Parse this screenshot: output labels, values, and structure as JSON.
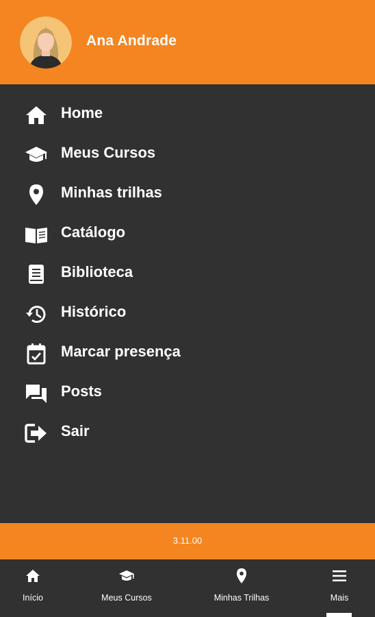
{
  "user": {
    "name": "Ana Andrade"
  },
  "menu": {
    "items": [
      {
        "label": "Home",
        "icon": "home-icon"
      },
      {
        "label": "Meus Cursos",
        "icon": "graduation-cap-icon"
      },
      {
        "label": "Minhas trilhas",
        "icon": "map-pin-icon"
      },
      {
        "label": "Catálogo",
        "icon": "open-book-icon"
      },
      {
        "label": "Biblioteca",
        "icon": "book-icon"
      },
      {
        "label": "Histórico",
        "icon": "history-icon"
      },
      {
        "label": "Marcar presença",
        "icon": "calendar-check-icon"
      },
      {
        "label": "Posts",
        "icon": "chat-bubbles-icon"
      },
      {
        "label": "Sair",
        "icon": "logout-icon"
      }
    ]
  },
  "version": "3.11.00",
  "bottom_nav": {
    "tabs": [
      {
        "label": "Início",
        "icon": "home-icon"
      },
      {
        "label": "Meus Cursos",
        "icon": "graduation-cap-icon"
      },
      {
        "label": "Minhas Trilhas",
        "icon": "map-pin-icon"
      },
      {
        "label": "Mais",
        "icon": "menu-icon",
        "active": true
      }
    ]
  },
  "colors": {
    "accent": "#f48521",
    "background": "#313131",
    "text": "#ffffff"
  }
}
